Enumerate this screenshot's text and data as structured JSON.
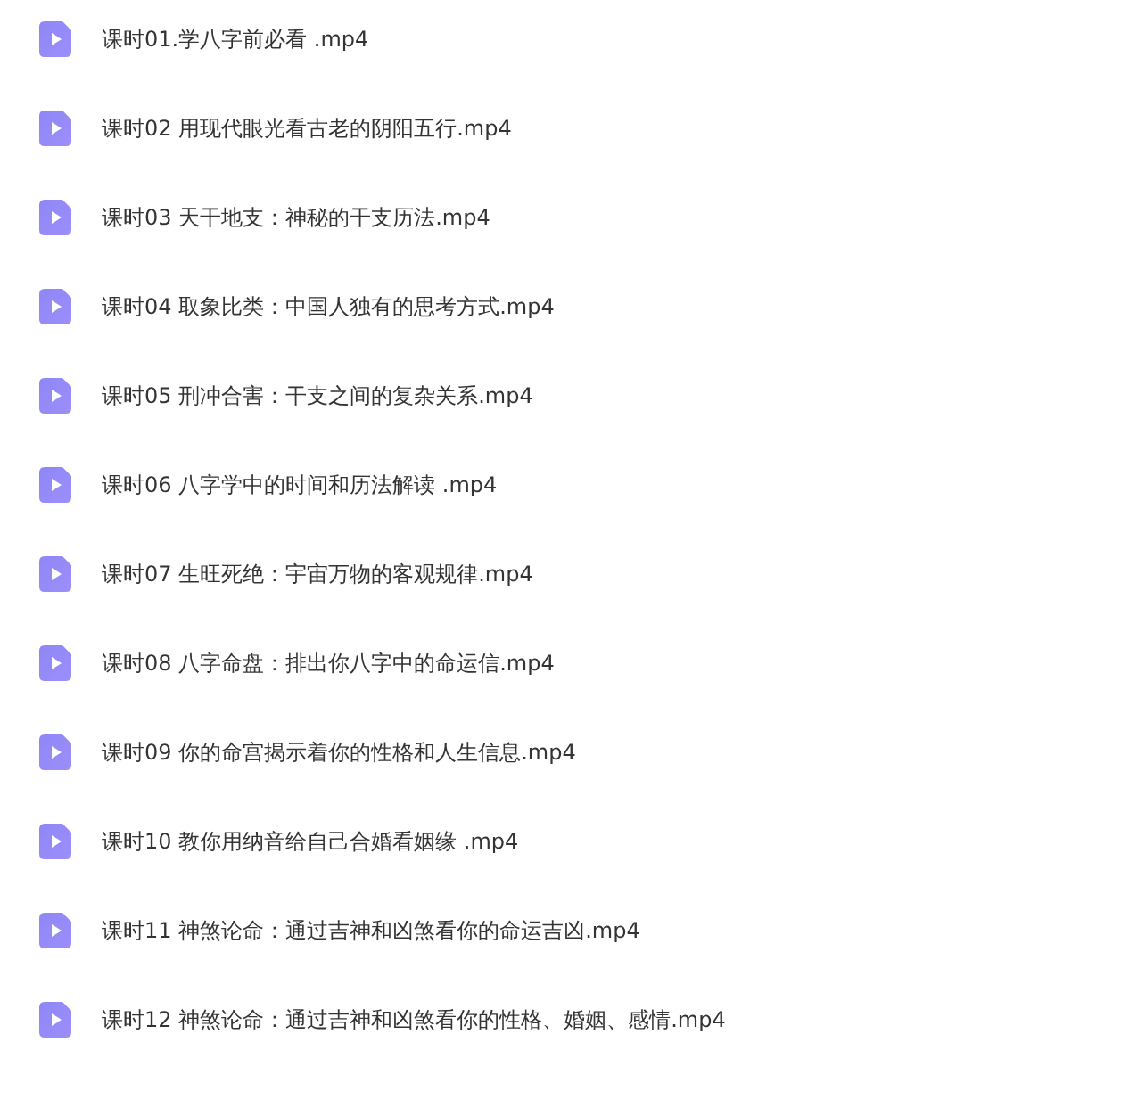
{
  "files": [
    {
      "name": "课时01.学八字前必看 .mp4",
      "kind": "video"
    },
    {
      "name": "课时02 用现代眼光看古老的阴阳五行.mp4",
      "kind": "video"
    },
    {
      "name": "课时03 天干地支：神秘的干支历法.mp4",
      "kind": "video"
    },
    {
      "name": "课时04 取象比类：中国人独有的思考方式.mp4",
      "kind": "video"
    },
    {
      "name": "课时05 刑冲合害：干支之间的复杂关系.mp4",
      "kind": "video"
    },
    {
      "name": "课时06 八字学中的时间和历法解读 .mp4",
      "kind": "video"
    },
    {
      "name": "课时07 生旺死绝：宇宙万物的客观规律.mp4",
      "kind": "video"
    },
    {
      "name": "课时08 八字命盘：排出你八字中的命运信.mp4",
      "kind": "video"
    },
    {
      "name": "课时09 你的命宫揭示着你的性格和人生信息.mp4",
      "kind": "video"
    },
    {
      "name": "课时10 教你用纳音给自己合婚看姻缘 .mp4",
      "kind": "video"
    },
    {
      "name": "课时11 神煞论命：通过吉神和凶煞看你的命运吉凶.mp4",
      "kind": "video"
    },
    {
      "name": "课时12 神煞论命：通过吉神和凶煞看你的性格、婚姻、感情.mp4",
      "kind": "video"
    }
  ]
}
